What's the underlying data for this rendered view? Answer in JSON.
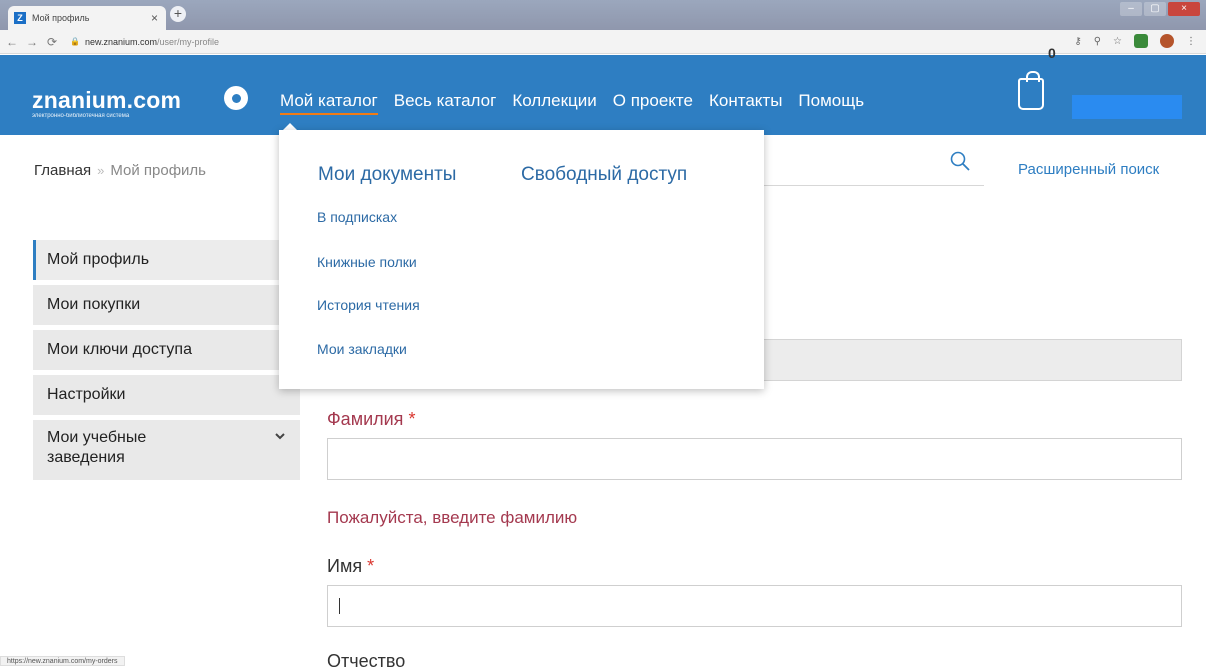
{
  "browser": {
    "tab_title": "Мой профиль",
    "favicon_letter": "Z",
    "tab_close": "×",
    "new_tab": "+",
    "url_host": "new.znanium.com",
    "url_path": "/user/my-profile",
    "status_url": "https://new.znanium.com/my-orders"
  },
  "header": {
    "logo_main": "znanium.com",
    "logo_sub": "электронно-библиотечная система",
    "nav": [
      "Мой каталог",
      "Весь каталог",
      "Коллекции",
      "О проекте",
      "Контакты",
      "Помощь"
    ],
    "active_nav": "Мой каталог",
    "cart_count": "0"
  },
  "breadcrumb": {
    "home": "Главная",
    "separator": "»",
    "current": "Мой профиль"
  },
  "search": {
    "advanced_label": "Расширенный поиск"
  },
  "dropdown": {
    "heading_docs": "Мои документы",
    "heading_free": "Свободный доступ",
    "links": [
      "В подписках",
      "Книжные полки",
      "История чтения",
      "Мои закладки"
    ]
  },
  "sidebar": {
    "items": [
      "Мой профиль",
      "Мои покупки",
      "Мои ключи доступа",
      "Настройки",
      "Мои учебные заведения"
    ],
    "active": "Мой профиль"
  },
  "form": {
    "surname_label": "Фамилия",
    "required_mark": "*",
    "surname_error": "Пожалуйста, введите фамилию",
    "name_label": "Имя",
    "patronymic_label": "Отчество",
    "surname_value": "",
    "name_value": ""
  },
  "colors": {
    "brand_blue": "#2e7ec2",
    "nav_active_underline": "#f07b14",
    "error_red": "#a4394f",
    "required_star": "#d9352e",
    "link_blue": "#2c6aa5"
  }
}
